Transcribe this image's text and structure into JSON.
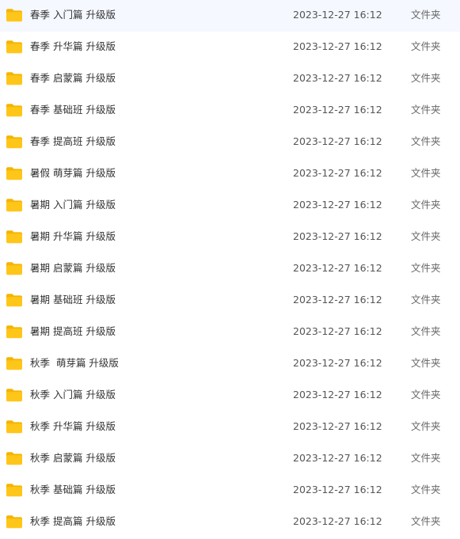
{
  "file_list": {
    "items": [
      {
        "name": "春季 入门篇 升级版",
        "modified": "2023-12-27 16:12",
        "type": "文件夹",
        "icon": "folder-icon"
      },
      {
        "name": "春季 升华篇 升级版",
        "modified": "2023-12-27 16:12",
        "type": "文件夹",
        "icon": "folder-icon"
      },
      {
        "name": "春季 启蒙篇 升级版",
        "modified": "2023-12-27 16:12",
        "type": "文件夹",
        "icon": "folder-icon"
      },
      {
        "name": "春季 基础班 升级版",
        "modified": "2023-12-27 16:12",
        "type": "文件夹",
        "icon": "folder-icon"
      },
      {
        "name": "春季 提高班 升级版",
        "modified": "2023-12-27 16:12",
        "type": "文件夹",
        "icon": "folder-icon"
      },
      {
        "name": "暑假 萌芽篇 升级版",
        "modified": "2023-12-27 16:12",
        "type": "文件夹",
        "icon": "folder-icon"
      },
      {
        "name": "暑期 入门篇 升级版",
        "modified": "2023-12-27 16:12",
        "type": "文件夹",
        "icon": "folder-icon"
      },
      {
        "name": "暑期 升华篇 升级版",
        "modified": "2023-12-27 16:12",
        "type": "文件夹",
        "icon": "folder-icon"
      },
      {
        "name": "暑期 启蒙篇 升级版",
        "modified": "2023-12-27 16:12",
        "type": "文件夹",
        "icon": "folder-icon"
      },
      {
        "name": "暑期 基础班 升级版",
        "modified": "2023-12-27 16:12",
        "type": "文件夹",
        "icon": "folder-icon"
      },
      {
        "name": "暑期 提高班 升级版",
        "modified": "2023-12-27 16:12",
        "type": "文件夹",
        "icon": "folder-icon"
      },
      {
        "name": "秋季  萌芽篇 升级版",
        "modified": "2023-12-27 16:12",
        "type": "文件夹",
        "icon": "folder-icon"
      },
      {
        "name": "秋季 入门篇 升级版",
        "modified": "2023-12-27 16:12",
        "type": "文件夹",
        "icon": "folder-icon"
      },
      {
        "name": "秋季 升华篇 升级版",
        "modified": "2023-12-27 16:12",
        "type": "文件夹",
        "icon": "folder-icon"
      },
      {
        "name": "秋季 启蒙篇 升级版",
        "modified": "2023-12-27 16:12",
        "type": "文件夹",
        "icon": "folder-icon"
      },
      {
        "name": "秋季 基础篇 升级版",
        "modified": "2023-12-27 16:12",
        "type": "文件夹",
        "icon": "folder-icon"
      },
      {
        "name": "秋季 提高篇 升级版",
        "modified": "2023-12-27 16:12",
        "type": "文件夹",
        "icon": "folder-icon"
      }
    ]
  },
  "colors": {
    "folder_body": "#ffc61a",
    "folder_tab": "#f5b400",
    "text": "#333333",
    "muted_text": "#666666"
  }
}
